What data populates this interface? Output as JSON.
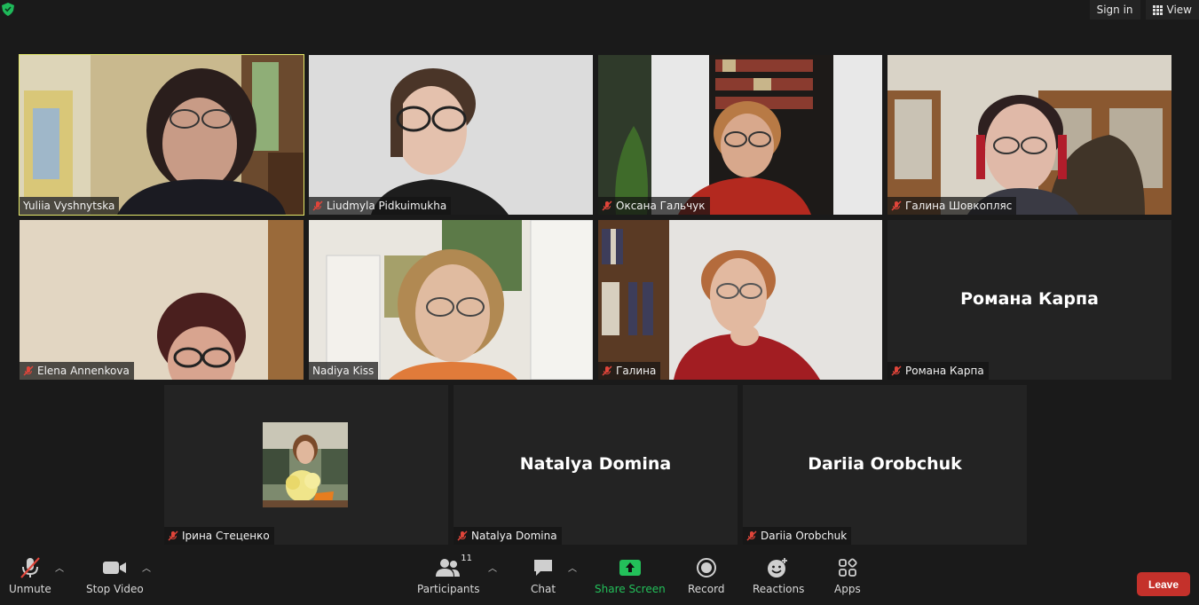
{
  "topbar": {
    "sign_in": "Sign in",
    "view": "View"
  },
  "participants": [
    {
      "name": "Yuliia Vyshnytska",
      "muted": false,
      "active": true
    },
    {
      "name": "Liudmyla Pidkuimukha",
      "muted": true
    },
    {
      "name": "Оксана Гальчук",
      "muted": true
    },
    {
      "name": "Галина Шовкопляс",
      "muted": true
    },
    {
      "name": "Elena Annenkova",
      "muted": true
    },
    {
      "name": "Nadiya Kiss",
      "muted": false
    },
    {
      "name": "Галина",
      "muted": true
    },
    {
      "name": "Романа Карпа",
      "muted": true,
      "video_off": true,
      "display": "Романа Карпа"
    },
    {
      "name": "Ірина Стеценко",
      "muted": true,
      "video_off": true,
      "avatar": true
    },
    {
      "name": "Natalya Domina",
      "muted": true,
      "video_off": true,
      "display": "Natalya Domina"
    },
    {
      "name": "Dariia Orobchuk",
      "muted": true,
      "video_off": true,
      "display": "Dariia Orobchuk"
    }
  ],
  "toolbar": {
    "unmute": "Unmute",
    "stop_video": "Stop Video",
    "participants": "Participants",
    "participant_count": "11",
    "chat": "Chat",
    "share_screen": "Share Screen",
    "record": "Record",
    "reactions": "Reactions",
    "apps": "Apps",
    "leave": "Leave"
  },
  "colors": {
    "active_border": "#e4e86a",
    "share_green": "#23c05a",
    "leave_red": "#c4312b",
    "mute_red": "#e0453a"
  }
}
